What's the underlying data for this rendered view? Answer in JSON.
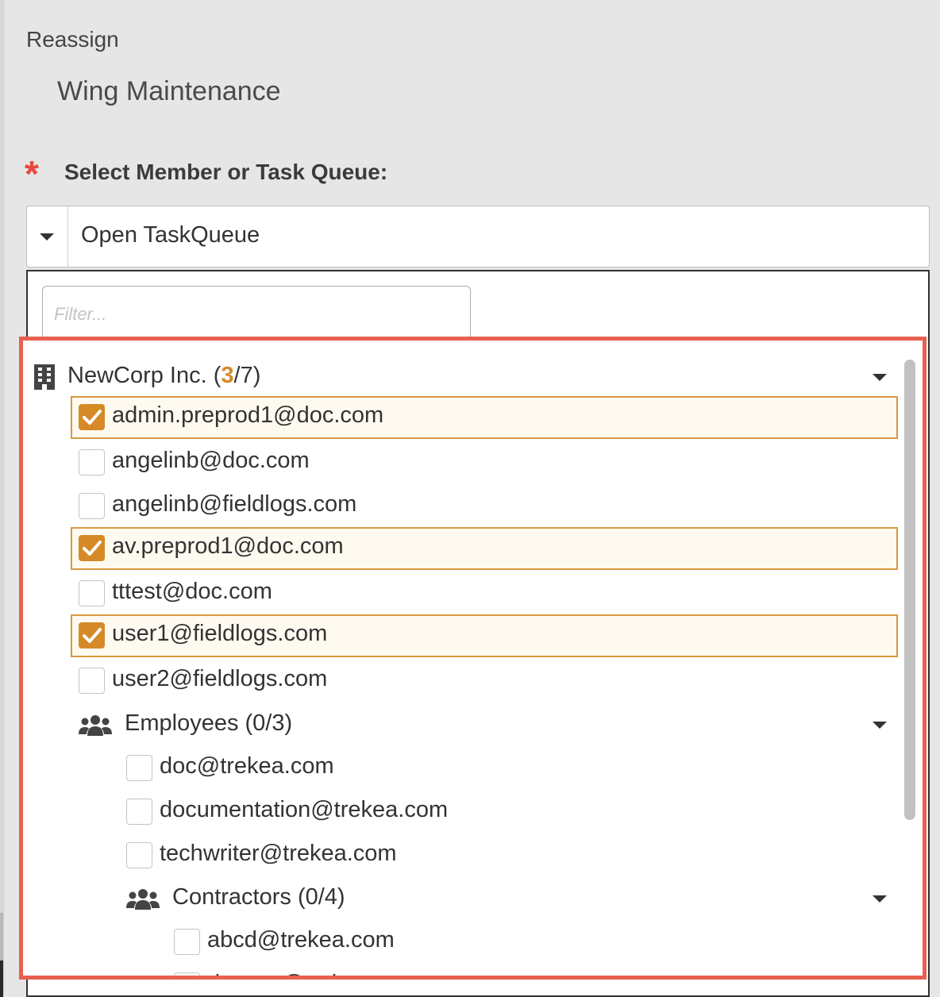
{
  "modal": {
    "title": "Reassign",
    "task_name": "Wing Maintenance",
    "required_marker": "*",
    "field_label": "Select Member or Task Queue:",
    "selected_value": "Open TaskQueue",
    "filter_placeholder": "Filter..."
  },
  "tree": {
    "org": {
      "name": "NewCorp Inc.",
      "checked_count": "3",
      "total_count": "/7"
    },
    "org_members": [
      {
        "email": "admin.preprod1@doc.com",
        "checked": true
      },
      {
        "email": "angelinb@doc.com",
        "checked": false
      },
      {
        "email": "angelinb@fieldlogs.com",
        "checked": false
      },
      {
        "email": "av.preprod1@doc.com",
        "checked": true
      },
      {
        "email": "tttest@doc.com",
        "checked": false
      },
      {
        "email": "user1@fieldlogs.com",
        "checked": true
      },
      {
        "email": "user2@fieldlogs.com",
        "checked": false
      }
    ],
    "employees": {
      "label": "Employees (0/3)",
      "members": [
        {
          "email": "doc@trekea.com",
          "checked": false
        },
        {
          "email": "documentation@trekea.com",
          "checked": false
        },
        {
          "email": "techwriter@trekea.com",
          "checked": false
        }
      ]
    },
    "contractors": {
      "label": "Contractors (0/4)",
      "members": [
        {
          "email": "abcd@trekea.com",
          "checked": false
        },
        {
          "email": "doctest@trekea.com",
          "checked": false
        }
      ]
    }
  },
  "colors": {
    "accent": "#d58a27",
    "highlight_border": "#e8604f",
    "required": "#e8473c"
  },
  "icons": {
    "org": "building-icon",
    "group": "users-icon",
    "expand": "caret-down-icon"
  }
}
